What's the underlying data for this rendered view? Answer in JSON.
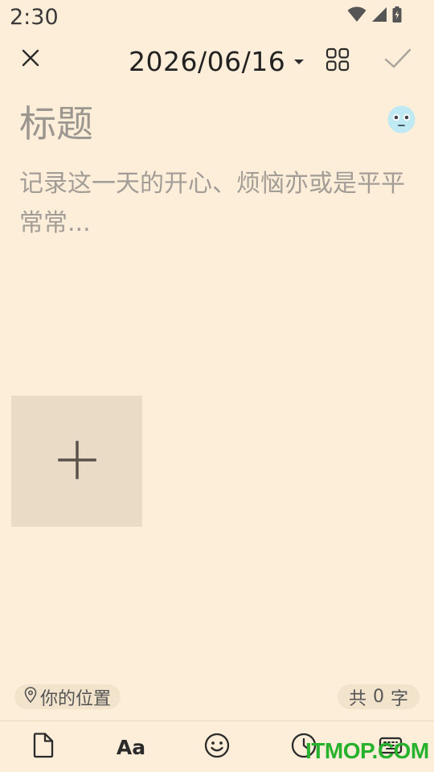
{
  "status_bar": {
    "time": "2:30",
    "icons": [
      "wifi-icon",
      "cellular-signal-icon",
      "battery-charging-icon"
    ]
  },
  "toolbar": {
    "date": "2026/06/16",
    "icons": [
      "close-icon",
      "dropdown-caret-icon",
      "grid-icon",
      "check-icon"
    ]
  },
  "editor": {
    "title_placeholder": "标题",
    "body_placeholder": "记录这一天的开心、烦恼亦或是平平常常...",
    "mood_icon": "face-emoji-icon"
  },
  "attachments": {
    "add_icon": "plus-icon"
  },
  "footer": {
    "location_label": "你的位置",
    "word_count_prefix": "共",
    "word_count": "0",
    "word_count_suffix": "字"
  },
  "bottom_bar": {
    "font_label": "Aa",
    "icons": [
      "document-icon",
      "font-icon",
      "smiley-icon",
      "clock-icon",
      "keyboard-icon"
    ]
  },
  "watermark": {
    "text": "ITMOP.COM"
  },
  "colors": {
    "background": "#fdeed9",
    "tile": "#e9dbc6",
    "watermark": "#27b22e"
  }
}
